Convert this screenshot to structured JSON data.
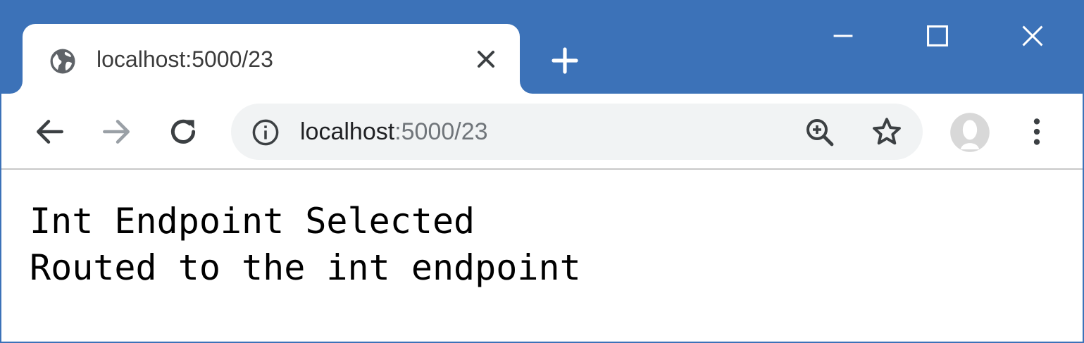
{
  "tab": {
    "title": "localhost:5000/23",
    "favicon_icon": "globe-icon",
    "close_icon": "close-icon"
  },
  "new_tab_icon": "plus-icon",
  "window_controls": {
    "minimize_icon": "minimize-icon",
    "maximize_icon": "maximize-icon",
    "close_icon": "close-icon"
  },
  "toolbar": {
    "back_icon": "arrow-left-icon",
    "forward_icon": "arrow-right-icon",
    "reload_icon": "reload-icon",
    "site_info_icon": "info-icon",
    "zoom_icon": "zoom-in-icon",
    "bookmark_icon": "star-icon",
    "profile_icon": "avatar-icon",
    "menu_icon": "more-vert-icon"
  },
  "address_bar": {
    "host": "localhost",
    "rest": ":5000/23"
  },
  "page": {
    "lines": [
      "Int Endpoint Selected",
      "Routed to the int endpoint"
    ]
  },
  "colors": {
    "frame": "#3c72b8",
    "omnibox": "#f1f3f4",
    "text": "#000000",
    "url_muted": "#70757a"
  }
}
